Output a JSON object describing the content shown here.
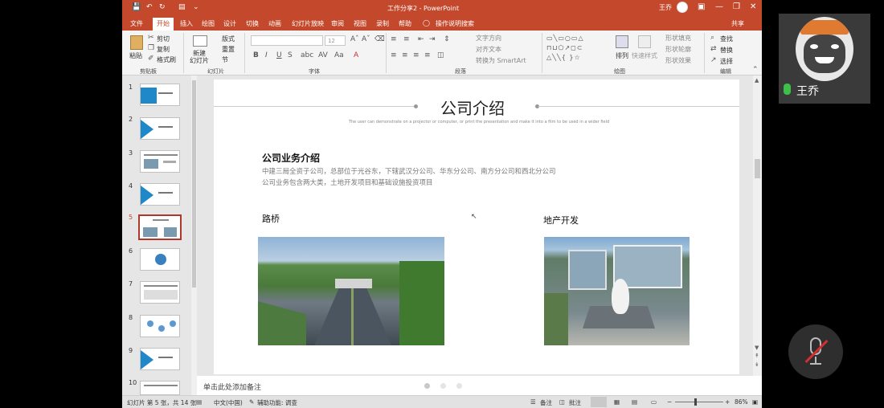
{
  "app": {
    "title": "工作分享2 - PowerPoint",
    "user_name": "王乔",
    "share_label": "共享"
  },
  "tabs": [
    "文件",
    "开始",
    "插入",
    "绘图",
    "设计",
    "切换",
    "动画",
    "幻灯片放映",
    "审阅",
    "视图",
    "录制",
    "帮助"
  ],
  "tell_me": "操作说明搜索",
  "ribbon": {
    "paste": "粘贴",
    "cut": "剪切",
    "copy": "复制",
    "format_painter": "格式刷",
    "group_clipboard": "剪贴板",
    "new_slide": "新建\n幻灯片",
    "layout": "版式",
    "reset": "重置",
    "section": "节",
    "group_slides": "幻灯片",
    "font_size": "12",
    "group_font": "字体",
    "text_direction": "文字方向",
    "align_text": "对齐文本",
    "convert_smartart": "转换为 SmartArt",
    "group_paragraph": "段落",
    "arrange": "排列",
    "quick_styles": "快速样式",
    "shape_fill": "形状填充",
    "shape_outline": "形状轮廓",
    "shape_effects": "形状效果",
    "group_drawing": "绘图",
    "find": "查找",
    "replace": "替换",
    "select": "选择",
    "group_editing": "编辑"
  },
  "thumbnails": [
    {
      "num": "1",
      "kind": "title"
    },
    {
      "num": "2",
      "kind": "section"
    },
    {
      "num": "3",
      "kind": "content"
    },
    {
      "num": "4",
      "kind": "section"
    },
    {
      "num": "5",
      "kind": "current"
    },
    {
      "num": "6",
      "kind": "globe"
    },
    {
      "num": "7",
      "kind": "text"
    },
    {
      "num": "8",
      "kind": "diagram"
    },
    {
      "num": "9",
      "kind": "section"
    },
    {
      "num": "10",
      "kind": "text"
    }
  ],
  "slide": {
    "title": "公司介绍",
    "subtitle": "The user can demonstrate on a projector or computer, or print the presentation and make it into a film to be used in a wider field",
    "section_heading": "公司业务介绍",
    "body_line1": "中建三局全资子公司，总部位于光谷东，下辖武汉分公司、华东分公司、南方分公司和西北分公司",
    "body_line2": "公司业务包含两大类，土地开发项目和基础设施投资项目",
    "label_left": "路桥",
    "label_right": "地产开发"
  },
  "notes_placeholder": "单击此处添加备注",
  "status": {
    "slide_info": "幻灯片 第 5 张，共 14 张",
    "language": "中文(中国)",
    "accessibility": "辅助功能: 调查",
    "notes": "备注",
    "comments": "批注",
    "zoom": "86%"
  },
  "participant": {
    "name": "王乔"
  }
}
